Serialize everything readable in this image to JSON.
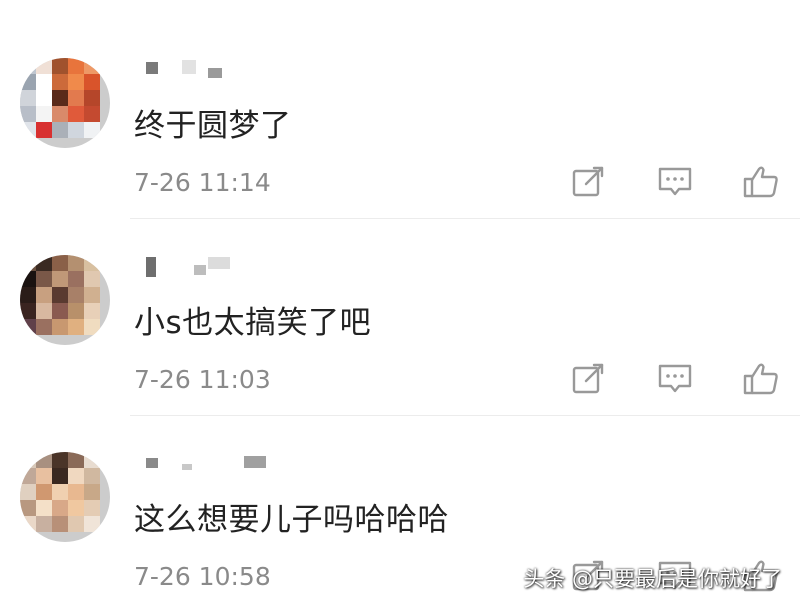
{
  "comments": [
    {
      "text": "终于圆梦了",
      "time": "7-26 11:14"
    },
    {
      "text": "小s也太搞笑了吧",
      "time": "7-26 11:03"
    },
    {
      "text": "这么想要儿子吗哈哈哈",
      "time": "7-26 10:58"
    }
  ],
  "icons": {
    "share": "share-edit-icon",
    "reply": "comment-bubble-icon",
    "like": "thumbs-up-icon"
  },
  "colors": {
    "text": "#222222",
    "meta": "#8a8a8a",
    "icon": "#999999"
  },
  "watermark": "头条 @只要最后是你就好了"
}
